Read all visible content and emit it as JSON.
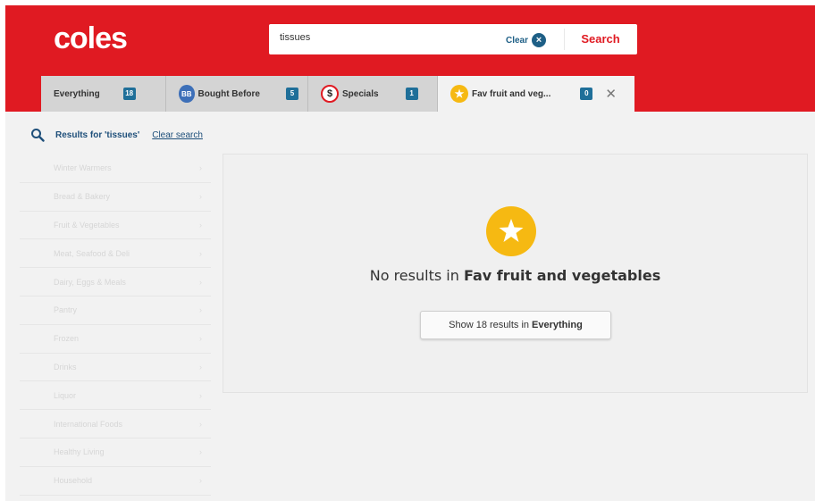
{
  "header": {
    "logo": "coles",
    "search": {
      "value": "tissues",
      "clear_label": "Clear",
      "button_label": "Search"
    }
  },
  "tabs": [
    {
      "label": "Everything",
      "count": "18"
    },
    {
      "label": "Bought Before",
      "count": "5",
      "icon_text": "BB"
    },
    {
      "label": "Specials",
      "count": "1",
      "icon_text": "$"
    },
    {
      "label": "Fav fruit and veg...",
      "count": "0",
      "active": true
    }
  ],
  "results": {
    "text": "Results for 'tissues'",
    "clear_search": "Clear search"
  },
  "sidebar": {
    "categories": [
      "Winter Warmers",
      "Bread & Bakery",
      "Fruit & Vegetables",
      "Meat, Seafood & Deli",
      "Dairy, Eggs & Meals",
      "Pantry",
      "Frozen",
      "Drinks",
      "Liquor",
      "International Foods",
      "Healthy Living",
      "Household"
    ]
  },
  "empty_state": {
    "prefix": "No results in",
    "list_name": "Fav fruit and vegetables",
    "button_prefix": "Show 18 results in",
    "button_target": "Everything"
  },
  "colors": {
    "brand_red": "#e01a22",
    "accent_blue": "#1f6f99",
    "star_yellow": "#f6b912"
  }
}
